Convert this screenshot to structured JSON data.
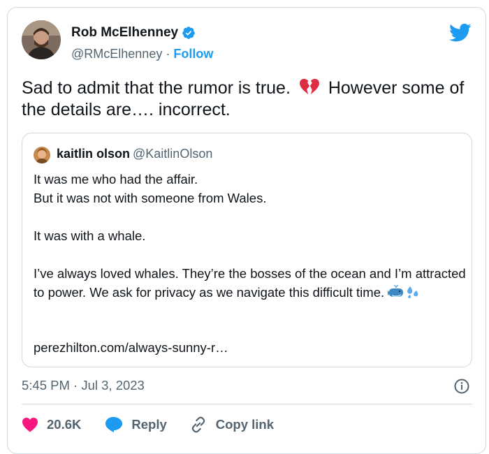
{
  "author": {
    "name": "Rob McElhenney",
    "handle": "@RMcElhenney",
    "separator": " · ",
    "follow_label": "Follow",
    "verified_color": "#1d9bf0"
  },
  "tweet": {
    "text_before_emoji": "Sad to admit that the rumor is true.",
    "emoji": "broken-heart",
    "text_after_emoji": "However some of the details are…. incorrect."
  },
  "quoted_tweet": {
    "author_name": "kaitlin olson",
    "author_handle": "@KaitlinOlson",
    "lines": [
      "It was me who had the affair.",
      "But it was not with someone from Wales.",
      "",
      "It was with a whale.",
      "",
      "I’ve always loved whales. They’re the bosses of the ocean and I’m attracted to power. We ask for privacy as we navigate this difficult time."
    ],
    "emojis": [
      "whale",
      "sweat-droplets"
    ],
    "link": "perezhilton.com/always-sunny-r…"
  },
  "meta": {
    "timestamp": "5:45 PM · Jul 3, 2023"
  },
  "actions": {
    "likes": "20.6K",
    "reply_label": "Reply",
    "copy_link_label": "Copy link"
  },
  "colors": {
    "accent": "#1d9bf0",
    "like": "#f91880",
    "text": "#0f1419",
    "secondary": "#536471",
    "border": "#cfd9de"
  }
}
